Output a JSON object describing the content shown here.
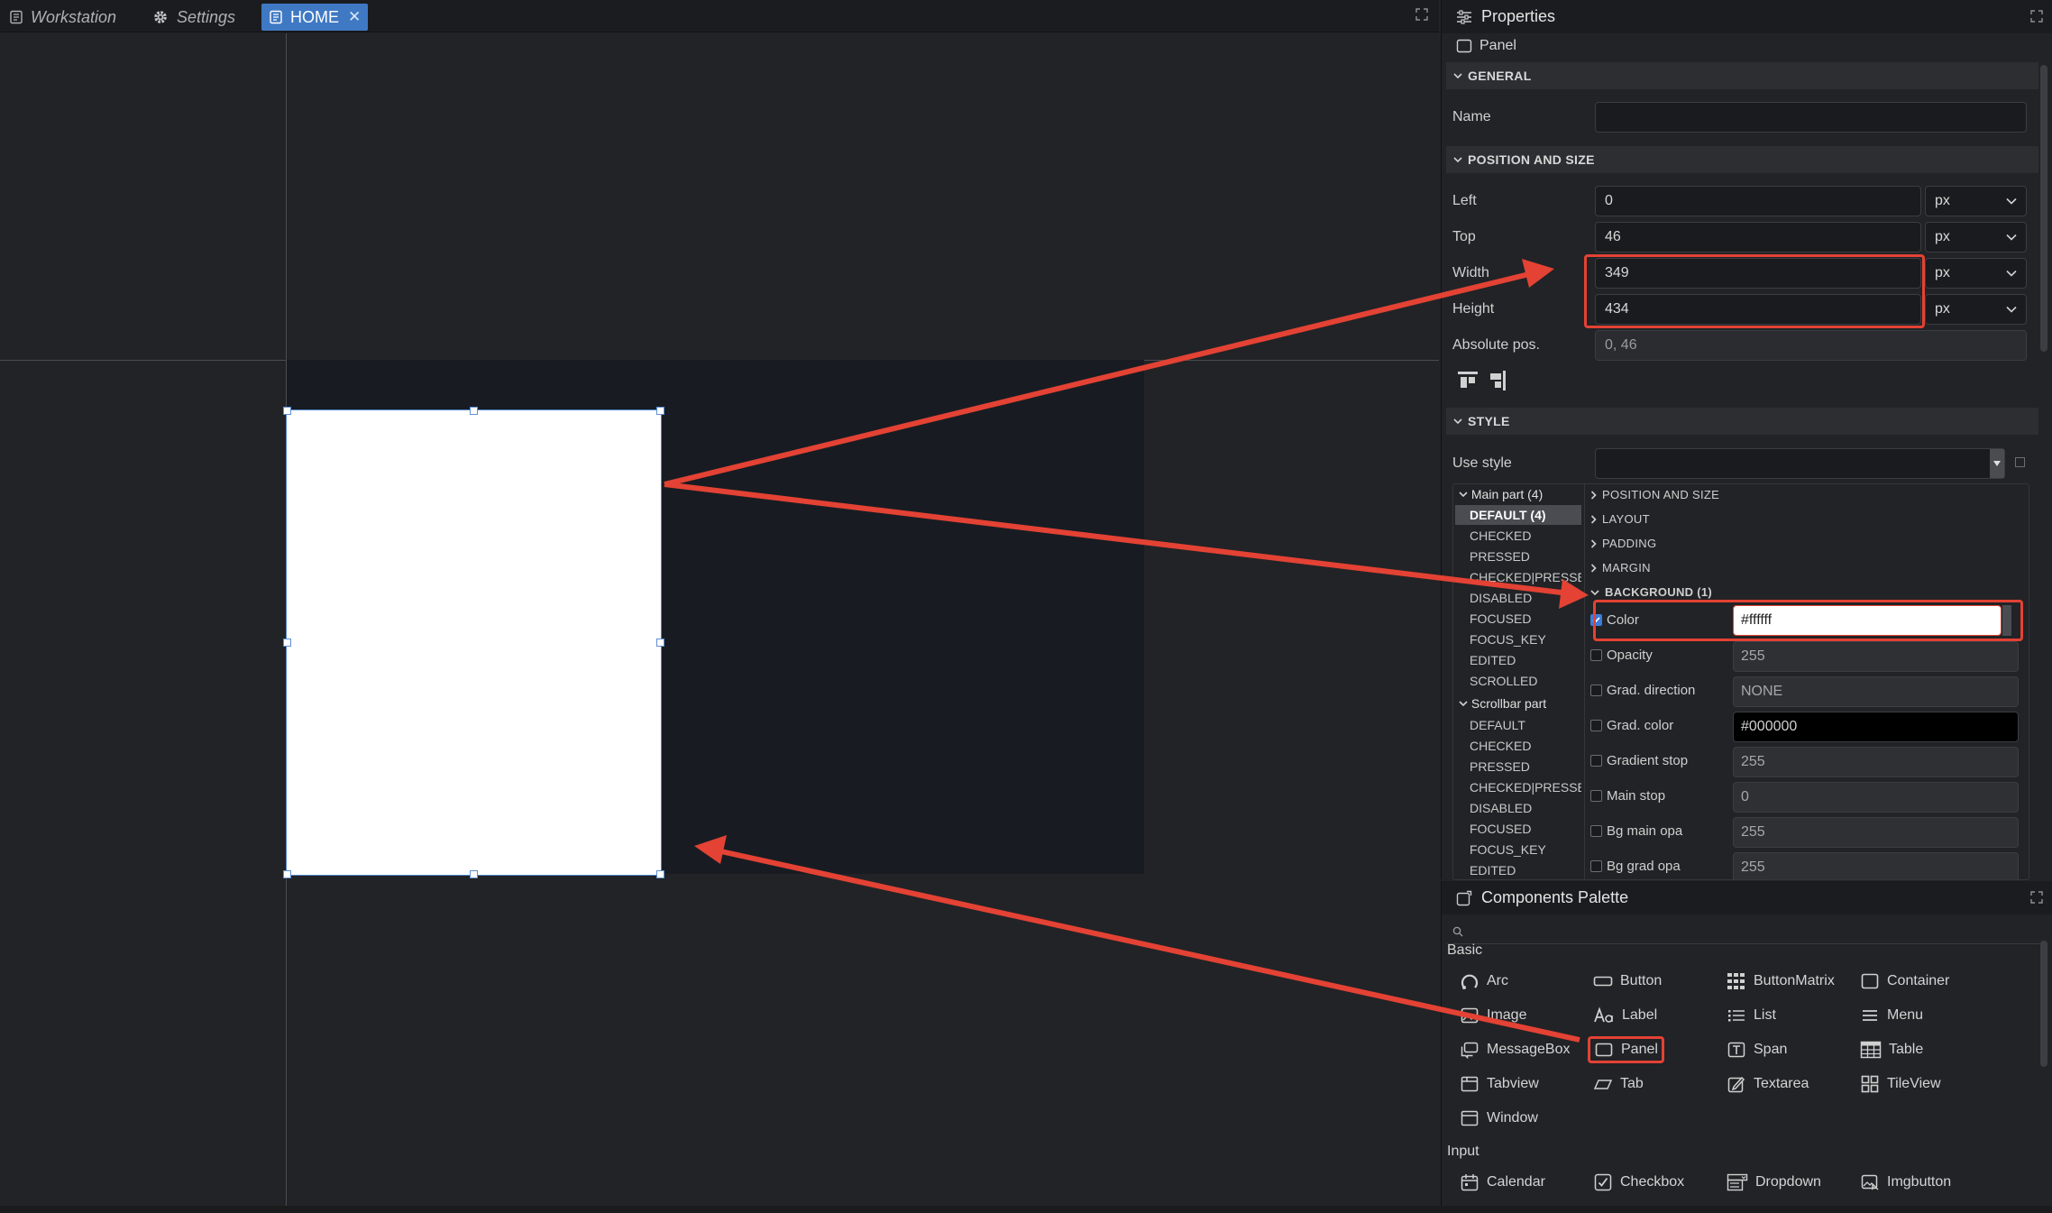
{
  "tabs": [
    {
      "label": "Workstation",
      "icon": "document-icon"
    },
    {
      "label": "Settings",
      "icon": "gear-icon"
    },
    {
      "label": "HOME",
      "icon": "document-icon",
      "active": true,
      "close": "✕"
    }
  ],
  "properties": {
    "title": "Properties",
    "widget_type": "Panel",
    "general": {
      "header": "GENERAL",
      "name_label": "Name",
      "name_value": ""
    },
    "position": {
      "header": "POSITION AND SIZE",
      "left_label": "Left",
      "left_value": "0",
      "left_unit": "px",
      "top_label": "Top",
      "top_value": "46",
      "top_unit": "px",
      "width_label": "Width",
      "width_value": "349",
      "width_unit": "px",
      "height_label": "Height",
      "height_value": "434",
      "height_unit": "px",
      "abs_label": "Absolute pos.",
      "abs_value": "0, 46"
    },
    "style": {
      "header": "STYLE",
      "use_style_label": "Use style",
      "use_style_value": "",
      "main_part": "Main part (4)",
      "main_states": [
        "DEFAULT (4)",
        "CHECKED",
        "PRESSED",
        "CHECKED|PRESSED",
        "DISABLED",
        "FOCUSED",
        "FOCUS_KEY",
        "EDITED",
        "SCROLLED"
      ],
      "scrollbar_part": "Scrollbar part",
      "scrollbar_states": [
        "DEFAULT",
        "CHECKED",
        "PRESSED",
        "CHECKED|PRESSED",
        "DISABLED",
        "FOCUSED",
        "FOCUS_KEY",
        "EDITED"
      ],
      "sections": [
        "POSITION AND SIZE",
        "LAYOUT",
        "PADDING",
        "MARGIN",
        "BACKGROUND (1)"
      ],
      "bg_props": [
        {
          "label": "Color",
          "value": "#ffffff",
          "checked": true
        },
        {
          "label": "Opacity",
          "value": "255",
          "checked": false
        },
        {
          "label": "Grad. direction",
          "value": "NONE",
          "checked": false
        },
        {
          "label": "Grad. color",
          "value": "#000000",
          "checked": false
        },
        {
          "label": "Gradient stop",
          "value": "255",
          "checked": false
        },
        {
          "label": "Main stop",
          "value": "0",
          "checked": false
        },
        {
          "label": "Bg main opa",
          "value": "255",
          "checked": false
        },
        {
          "label": "Bg grad opa",
          "value": "255",
          "checked": false
        }
      ]
    }
  },
  "palette": {
    "title": "Components Palette",
    "search_placeholder": "",
    "basic_label": "Basic",
    "basic": [
      {
        "label": "Arc",
        "icon": "arc-icon"
      },
      {
        "label": "Button",
        "icon": "button-icon"
      },
      {
        "label": "ButtonMatrix",
        "icon": "buttonmatrix-icon"
      },
      {
        "label": "Container",
        "icon": "container-icon"
      },
      {
        "label": "Image",
        "icon": "image-icon"
      },
      {
        "label": "Label",
        "icon": "label-icon"
      },
      {
        "label": "List",
        "icon": "list-icon"
      },
      {
        "label": "Menu",
        "icon": "menu-icon"
      },
      {
        "label": "MessageBox",
        "icon": "messagebox-icon"
      },
      {
        "label": "Panel",
        "icon": "panel-icon",
        "highlighted": true
      },
      {
        "label": "Span",
        "icon": "span-icon"
      },
      {
        "label": "Table",
        "icon": "table-icon"
      },
      {
        "label": "Tabview",
        "icon": "tabview-icon"
      },
      {
        "label": "Tab",
        "icon": "tab-icon"
      },
      {
        "label": "Textarea",
        "icon": "textarea-icon"
      },
      {
        "label": "TileView",
        "icon": "tileview-icon"
      },
      {
        "label": "Window",
        "icon": "window-icon"
      }
    ],
    "input_label": "Input",
    "input": [
      {
        "label": "Calendar",
        "icon": "calendar-icon"
      },
      {
        "label": "Checkbox",
        "icon": "checkbox-icon"
      },
      {
        "label": "Dropdown",
        "icon": "dropdown-icon"
      },
      {
        "label": "Imgbutton",
        "icon": "imgbutton-icon"
      }
    ]
  },
  "colors": {
    "accent": "#3f79c4",
    "annotation": "#e34234",
    "panel_bg": "#ffffff",
    "canvas": "#222326"
  }
}
